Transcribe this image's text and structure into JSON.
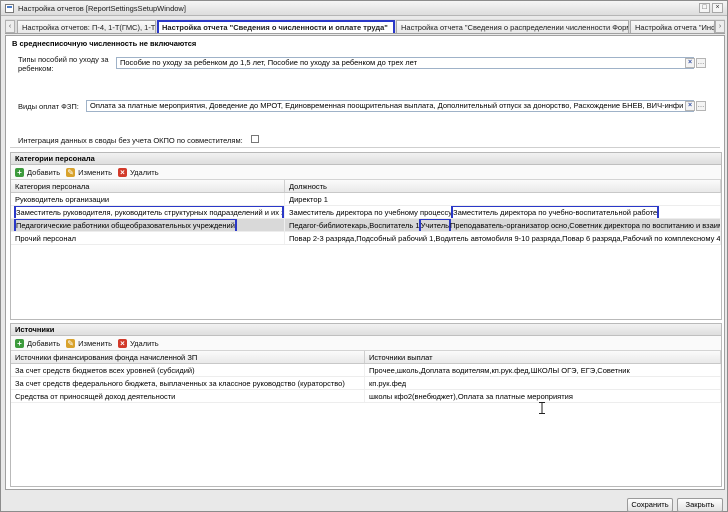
{
  "window": {
    "title": "Настройка отчетов [ReportSettingsSetupWindow]"
  },
  "tabs": [
    "Настройка отчетов: П-4, 1-Т(ГМС), 1-Т",
    "Настройка отчета \"Сведения о численности и оплате труда\"",
    "Настройка отчета \"Сведения о распределении численности Форма №1\"",
    "Настройка отчета \"Инфор"
  ],
  "form": {
    "legend": "В среднесписочную численность не включаются",
    "benefit_types_label": "Типы пособий по уходу за ребенком:",
    "benefit_types_value": "Пособие по уходу за ребенком до 1,5 лет, Пособие по уходу за ребенком до трех лет",
    "payment_types_label": "Виды оплат ФЗП:",
    "payment_types_value": "Оплата за платные мероприятия, Доведение до МРОТ, Единовременная поощрительная выплата, Дополнительный отпуск за донорство, Расхождение БНЕВ, ВИЧ-инфи",
    "integration_label": "Интеграция данных в своды без учета ОКПО по совместителям:"
  },
  "toolbar": {
    "add": "Добавить",
    "edit": "Изменить",
    "delete": "Удалить"
  },
  "categories": {
    "header": "Категории персонала",
    "columns": [
      "Категория персонала",
      "Должность"
    ],
    "rows": [
      [
        "Руководитель организации",
        "Директор 1"
      ],
      [
        "Заместитель руководителя, руководитель структурных подразделений и их замести",
        "Заместитель директора по учебному процессу",
        "Заместитель директора по учебно-воспитательной работе"
      ],
      [
        "Педагогические работники общеобразовательных учреждений",
        "Педагог-библиотекарь,Воспитатель 1",
        "Учитель",
        "Преподаватель-организатор осно,Советник директора по воспитанию и взаимодейст..."
      ],
      [
        "Прочий персонал",
        "Повар 2-3 разряда,Подсобный рабочий 1,Водитель автомобиля 9-10 разряда,Повар 6 разряда,Рабочий по комплексному 4 обслужи..."
      ]
    ]
  },
  "sources": {
    "header": "Источники",
    "columns": [
      "Источники финансирования фонда начисленной ЗП",
      "Источники выплат"
    ],
    "rows": [
      [
        "За счет средств бюджетов всех уровней (субсидий)",
        "Прочее,школь,Доплата водителям,кп.рук.фед,ШКОЛЫ ОГЭ, ЕГЭ,Советник"
      ],
      [
        "За счет средств федерального бюджета, выплаченных за классное руководство (кураторство)",
        "кп.рук.фед"
      ],
      [
        "Средства от приносящей доход деятельности",
        "школы кфо2(внебюджет),Оплата за платные мероприятия"
      ]
    ]
  },
  "footer": {
    "save": "Сохранить",
    "close": "Закрыть"
  }
}
